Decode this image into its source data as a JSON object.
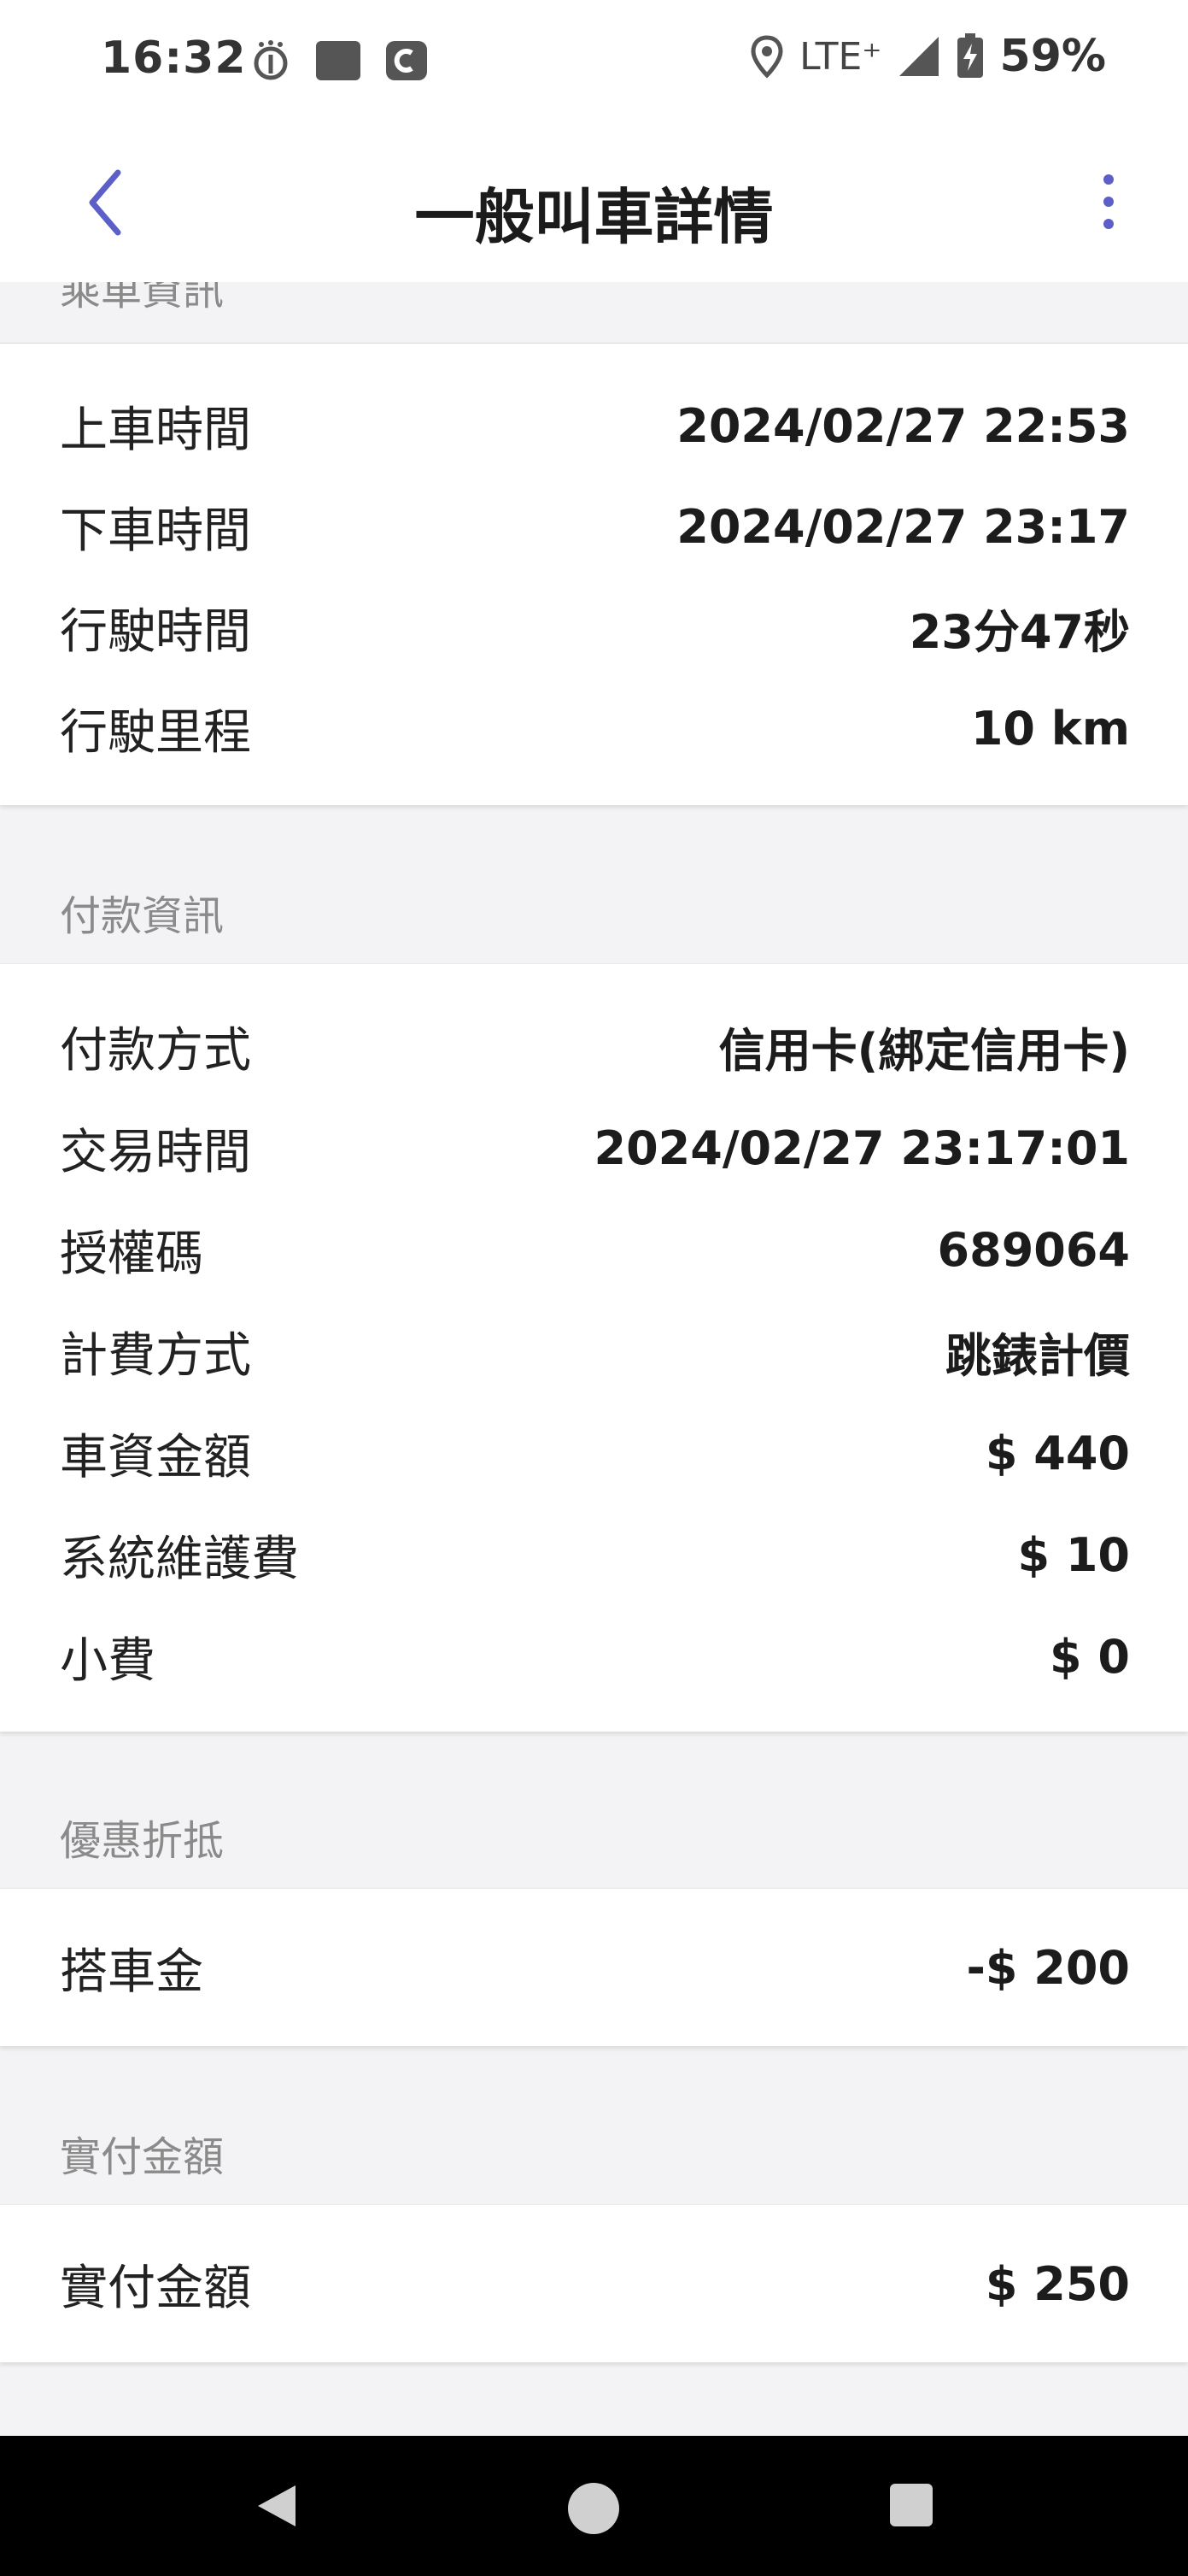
{
  "status_bar": {
    "time": "16:32",
    "network": "LTE⁺",
    "battery": "59%",
    "icons": [
      "fingerprint-app-icon",
      "app-square-icon",
      "app-c-icon",
      "location-icon",
      "signal-icon",
      "battery-charging-icon"
    ]
  },
  "app_bar": {
    "title": "一般叫車詳情",
    "back_icon": "chevron-left-icon",
    "more_icon": "more-vertical-icon",
    "accent": "#5b5fc7"
  },
  "sections": {
    "ride": {
      "header": "乘車資訊",
      "rows": [
        {
          "label": "上車時間",
          "value": "2024/02/27 22:53"
        },
        {
          "label": "下車時間",
          "value": "2024/02/27 23:17"
        },
        {
          "label": "行駛時間",
          "value": "23分47秒"
        },
        {
          "label": "行駛里程",
          "value": "10 km"
        }
      ]
    },
    "payment": {
      "header": "付款資訊",
      "rows": [
        {
          "label": "付款方式",
          "value": "信用卡(綁定信用卡)"
        },
        {
          "label": "交易時間",
          "value": "2024/02/27 23:17:01"
        },
        {
          "label": "授權碼",
          "value": "689064"
        },
        {
          "label": "計費方式",
          "value": "跳錶計價"
        },
        {
          "label": "車資金額",
          "value": "$ 440"
        },
        {
          "label": "系統維護費",
          "value": "$ 10"
        },
        {
          "label": "小費",
          "value": "$ 0"
        }
      ]
    },
    "discount": {
      "header": "優惠折抵",
      "rows": [
        {
          "label": "搭車金",
          "value": "-$ 200"
        }
      ]
    },
    "paid": {
      "header": "實付金額",
      "rows": [
        {
          "label": "實付金額",
          "value": "$ 250"
        }
      ]
    }
  },
  "nav_bar": {
    "back_icon": "nav-back-triangle-icon",
    "home_icon": "nav-home-circle-icon",
    "recents_icon": "nav-recents-square-icon"
  }
}
